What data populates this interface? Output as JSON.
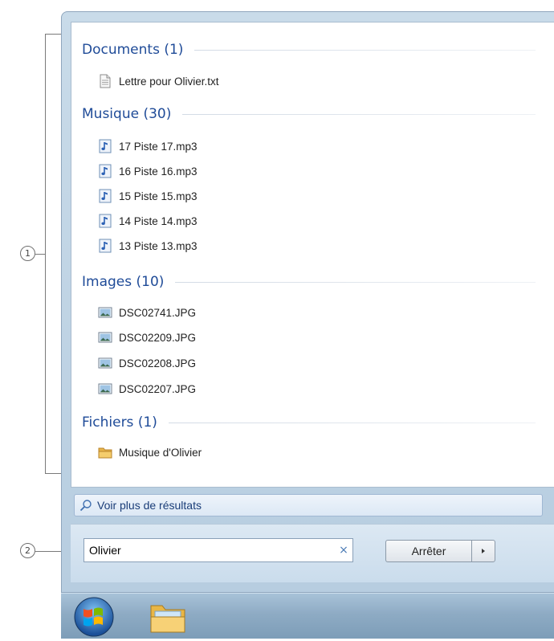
{
  "callouts": {
    "one": "1",
    "two": "2"
  },
  "groups": [
    {
      "header": "Documents (1)",
      "items": [
        {
          "label": "Lettre pour Olivier.txt",
          "icon": "text-file-icon"
        }
      ]
    },
    {
      "header": "Musique (30)",
      "items": [
        {
          "label": "17 Piste 17.mp3",
          "icon": "music-file-icon"
        },
        {
          "label": "16 Piste 16.mp3",
          "icon": "music-file-icon"
        },
        {
          "label": "15 Piste 15.mp3",
          "icon": "music-file-icon"
        },
        {
          "label": "14 Piste 14.mp3",
          "icon": "music-file-icon"
        },
        {
          "label": "13 Piste 13.mp3",
          "icon": "music-file-icon"
        }
      ]
    },
    {
      "header": "Images (10)",
      "items": [
        {
          "label": "DSC02741.JPG",
          "icon": "image-file-icon"
        },
        {
          "label": "DSC02209.JPG",
          "icon": "image-file-icon"
        },
        {
          "label": "DSC02208.JPG",
          "icon": "image-file-icon"
        },
        {
          "label": "DSC02207.JPG",
          "icon": "image-file-icon"
        }
      ]
    },
    {
      "header": "Fichiers (1)",
      "items": [
        {
          "label": "Musique d'Olivier",
          "icon": "folder-icon"
        }
      ]
    }
  ],
  "more_results": "Voir plus de résultats",
  "search": {
    "value": "Olivier",
    "clear_glyph": "×"
  },
  "shutdown": {
    "label": "Arrêter"
  },
  "colors": {
    "header": "#1f4b98",
    "accent": "#4a7ab5"
  }
}
